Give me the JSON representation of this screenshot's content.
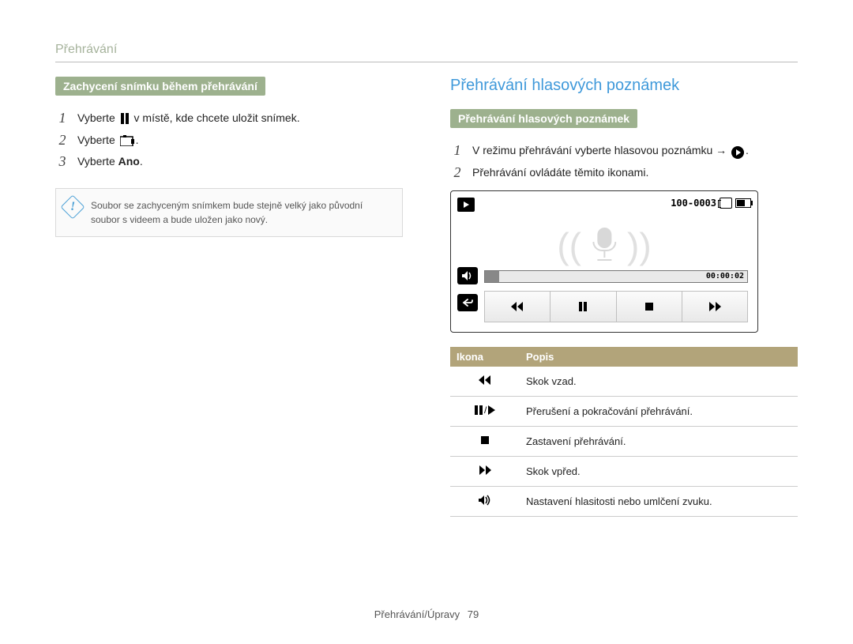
{
  "page_title": "Přehrávání",
  "left": {
    "subheader": "Zachycení snímku během přehrávání",
    "step1_a": "Vyberte ",
    "step1_b": " v místě, kde chcete uložit snímek.",
    "step2": "Vyberte ",
    "step3_a": "Vyberte ",
    "step3_b": "Ano",
    "note": "Soubor se zachyceným snímkem bude stejně velký jako původní soubor s videem a bude uložen jako nový."
  },
  "right": {
    "section_title": "Přehrávání hlasových poznámek",
    "subheader": "Přehrávání hlasových poznámek",
    "step1_a": "V režimu přehrávání vyberte hlasovou poznámku → ",
    "step2": "Přehrávání ovládáte těmito ikonami.",
    "device": {
      "file_code": "100-0003",
      "progress_time": "00:00:02"
    },
    "table": {
      "th_icon": "Ikona",
      "th_desc": "Popis",
      "rows": [
        {
          "icon": "rewind",
          "desc": "Skok vzad."
        },
        {
          "icon": "pause-play",
          "desc": "Přerušení a pokračování přehrávání."
        },
        {
          "icon": "stop",
          "desc": "Zastavení přehrávání."
        },
        {
          "icon": "forward",
          "desc": "Skok vpřed."
        },
        {
          "icon": "volume",
          "desc": "Nastavení hlasitosti nebo umlčení zvuku."
        }
      ]
    }
  },
  "footer": {
    "section": "Přehrávání/Úpravy",
    "page": "79"
  }
}
